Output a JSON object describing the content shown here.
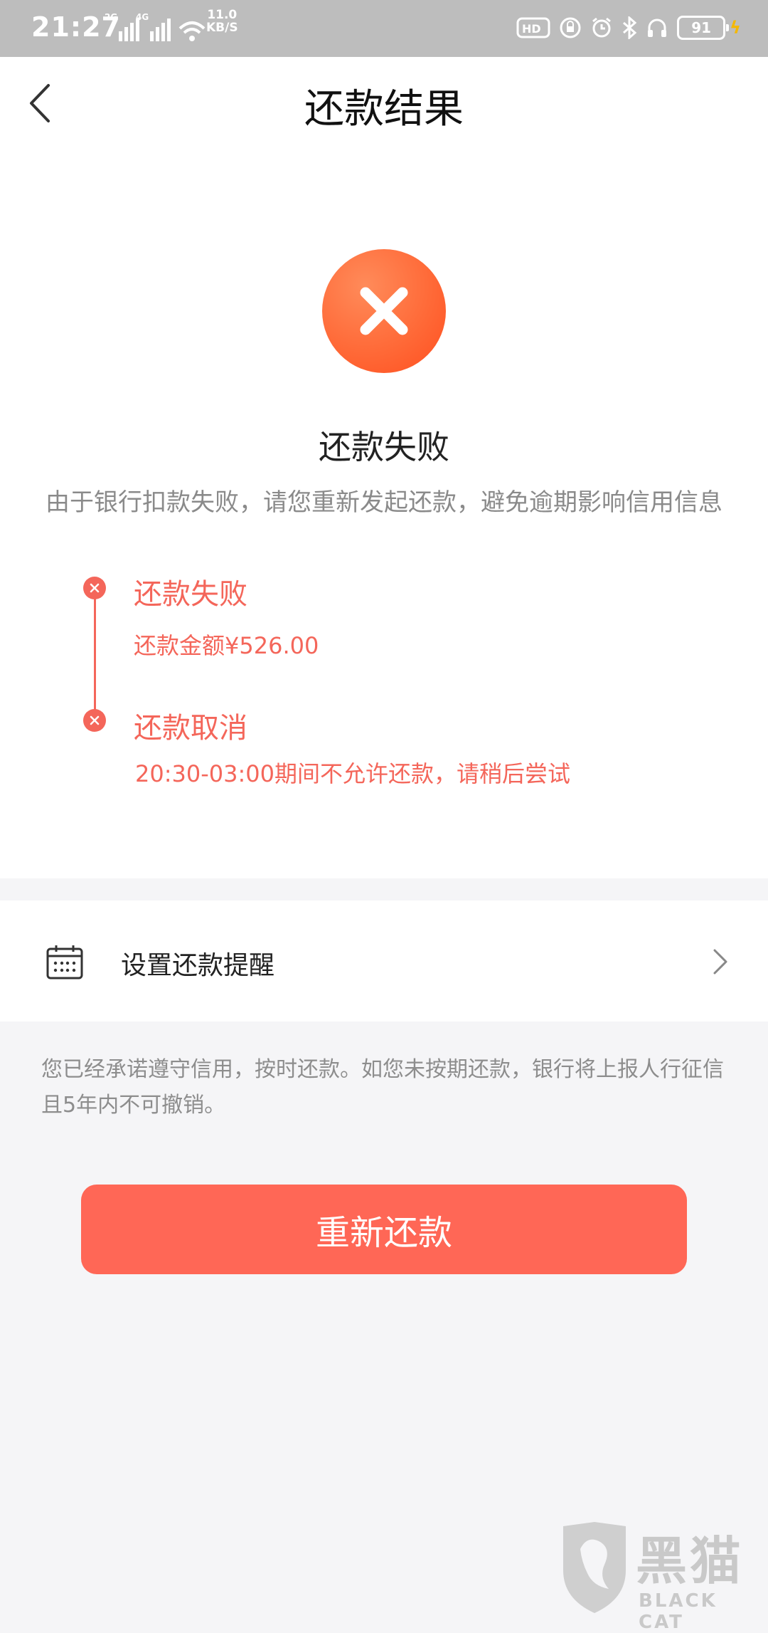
{
  "status_bar": {
    "time": "21:27",
    "net_label_1": "2G",
    "net_label_2": "4G",
    "speed_value": "11.0",
    "speed_unit": "KB/S",
    "battery": "91"
  },
  "header": {
    "title": "还款结果"
  },
  "result": {
    "title": "还款失败",
    "description": "由于银行扣款失败，请您重新发起还款，避免逾期影响信用信息"
  },
  "timeline": [
    {
      "title": "还款失败",
      "detail": "还款金额¥526.00"
    },
    {
      "title": "还款取消",
      "detail": "20:30-03:00期间不允许还款，请稍后尝试"
    }
  ],
  "reminder": {
    "label": "设置还款提醒"
  },
  "notice": "您已经承诺遵守信用，按时还款。如您未按期还款，银行将上报人行征信且5年内不可撤销。",
  "retry_button": "重新还款",
  "watermark": {
    "cn": "黑猫",
    "en": "BLACK CAT"
  },
  "colors": {
    "accent": "#ff6756",
    "error": "#f4665a"
  }
}
